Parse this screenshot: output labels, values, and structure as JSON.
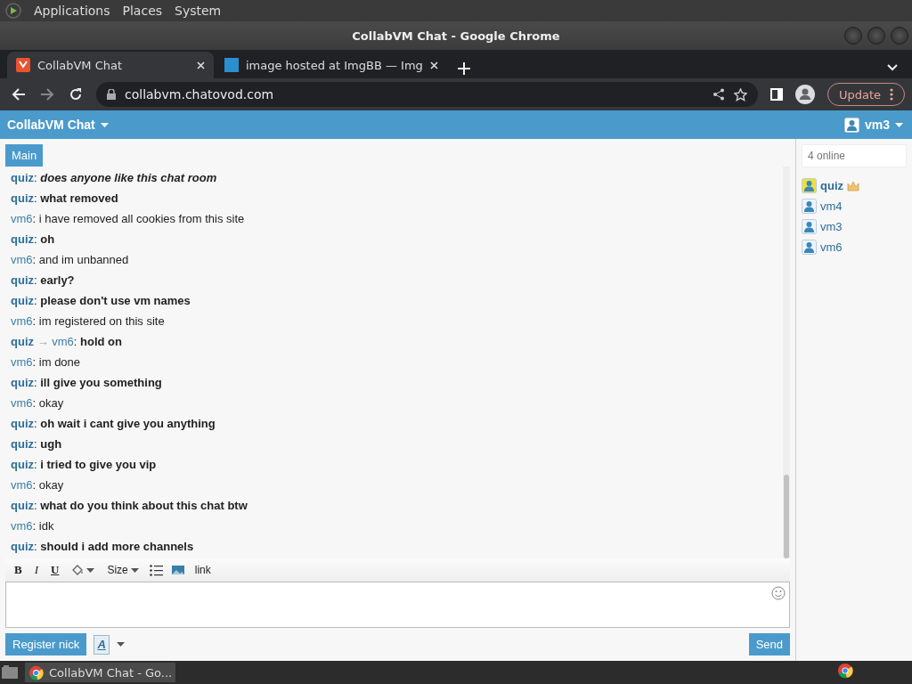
{
  "top_panel": {
    "menus": [
      "Applications",
      "Places",
      "System"
    ]
  },
  "window": {
    "title": "CollabVM Chat - Google Chrome"
  },
  "tabs": [
    {
      "label": "CollabVM Chat",
      "selected": true
    },
    {
      "label": "image hosted at ImgBB — Img",
      "selected": false
    }
  ],
  "address_bar": {
    "url": "collabvm.chatovod.com"
  },
  "update_button": "Update",
  "header": {
    "title": "CollabVM Chat",
    "user": "vm3"
  },
  "channel_tabs": [
    {
      "label": "Main",
      "selected": true
    }
  ],
  "messages": [
    {
      "author": "quiz",
      "separator": ":",
      "text": "does anyone like this chat room",
      "bold": true,
      "italic": true
    },
    {
      "author": "quiz",
      "separator": ":",
      "text": "what removed",
      "bold": true,
      "italic": false
    },
    {
      "author": "vm6",
      "separator": ":",
      "text": "i have removed all cookies from this site",
      "bold": false,
      "italic": false
    },
    {
      "author": "quiz",
      "separator": ":",
      "text": "oh",
      "bold": true,
      "italic": false
    },
    {
      "author": "vm6",
      "separator": ":",
      "text": "and im unbanned",
      "bold": false,
      "italic": false
    },
    {
      "author": "quiz",
      "separator": ":",
      "text": "early?",
      "bold": true,
      "italic": false
    },
    {
      "author": "quiz",
      "separator": ":",
      "text": "please don't use vm names",
      "bold": true,
      "italic": false
    },
    {
      "author": "vm6",
      "separator": ":",
      "text": "im registered on this site",
      "bold": false,
      "italic": false
    },
    {
      "author": "quiz",
      "arrow": "→",
      "recipient": "vm6",
      "separator": ":",
      "text": "hold on",
      "bold": true,
      "italic": false
    },
    {
      "author": "vm6",
      "separator": ":",
      "text": "im done",
      "bold": false,
      "italic": false
    },
    {
      "author": "quiz",
      "separator": ":",
      "text": "ill give you something",
      "bold": true,
      "italic": false
    },
    {
      "author": "vm6",
      "separator": ":",
      "text": "okay",
      "bold": false,
      "italic": false
    },
    {
      "author": "quiz",
      "separator": ":",
      "text": "oh wait i cant give you anything",
      "bold": true,
      "italic": false
    },
    {
      "author": "quiz",
      "separator": ":",
      "text": "ugh",
      "bold": true,
      "italic": false
    },
    {
      "author": "quiz",
      "separator": ":",
      "text": "i tried to give you vip",
      "bold": true,
      "italic": false
    },
    {
      "author": "vm6",
      "separator": ":",
      "text": "okay",
      "bold": false,
      "italic": false
    },
    {
      "author": "quiz",
      "separator": ":",
      "text": "what do you think about this chat btw",
      "bold": true,
      "italic": false
    },
    {
      "author": "vm6",
      "separator": ":",
      "text": "idk",
      "bold": false,
      "italic": false
    },
    {
      "author": "quiz",
      "separator": ":",
      "text": "should i add more channels",
      "bold": true,
      "italic": false
    }
  ],
  "editor_toolbar": {
    "bold": "B",
    "italic": "I",
    "underline": "U",
    "size": "Size",
    "link": "link"
  },
  "register_button": "Register nick",
  "font_button": "A",
  "send_button": "Send",
  "online": {
    "count": "4 online",
    "users": [
      {
        "name": "quiz",
        "kind": "owner"
      },
      {
        "name": "vm4",
        "kind": "user"
      },
      {
        "name": "vm3",
        "kind": "user"
      },
      {
        "name": "vm6",
        "kind": "user"
      }
    ]
  },
  "taskbar": {
    "items": [
      {
        "label": "CollabVM Chat - Go...",
        "selected": true
      }
    ]
  }
}
